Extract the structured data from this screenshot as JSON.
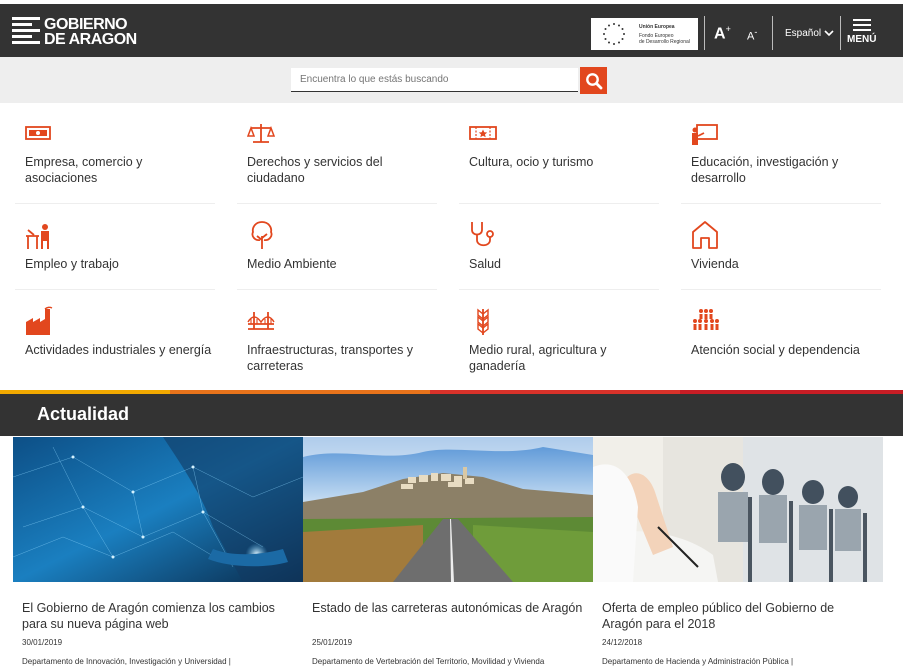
{
  "header": {
    "logo_line1": "GOBIERNO",
    "logo_line2": "DE ARAGON",
    "eu_line1": "Unión Europea",
    "eu_line2": "Fondo Europeo",
    "eu_line3": "de Desarrollo Regional",
    "font_increase": "A",
    "font_decrease": "A",
    "language": "Español",
    "menu_label": "MENÚ"
  },
  "search": {
    "placeholder": "Encuentra lo que estás buscando"
  },
  "categories": [
    {
      "label": "Empresa, comercio y asociaciones",
      "icon": "money-icon"
    },
    {
      "label": "Derechos y servicios del ciudadano",
      "icon": "scales-icon"
    },
    {
      "label": "Cultura, ocio y turismo",
      "icon": "ticket-icon"
    },
    {
      "label": "Educación, investigación y desarrollo",
      "icon": "blackboard-icon"
    },
    {
      "label": "Empleo y trabajo",
      "icon": "worker-desk-icon"
    },
    {
      "label": "Medio Ambiente",
      "icon": "tree-icon"
    },
    {
      "label": "Salud",
      "icon": "stethoscope-icon"
    },
    {
      "label": "Vivienda",
      "icon": "house-icon"
    },
    {
      "label": "Actividades industriales y energía",
      "icon": "factory-icon"
    },
    {
      "label": "Infraestructuras, transportes y carreteras",
      "icon": "bridge-icon"
    },
    {
      "label": "Medio rural, agricultura y ganadería",
      "icon": "wheat-icon"
    },
    {
      "label": "Atención social y dependencia",
      "icon": "people-group-icon"
    }
  ],
  "colors": {
    "accent": "#e2471e",
    "dark": "#333333",
    "bar": [
      "#f2a900",
      "#e8731b",
      "#d9322a",
      "#c81d25"
    ]
  },
  "news_section": {
    "title": "Actualidad",
    "items": [
      {
        "title": "El Gobierno de Aragón comienza los cambios para su nueva página web",
        "date": "30/01/2019",
        "department": "Departamento de Innovación, Investigación y Universidad   |"
      },
      {
        "title": "Estado de las carreteras autonómicas de Aragón",
        "date": "25/01/2019",
        "department": "Departamento de Vertebración del Territorio, Movilidad y Vivienda"
      },
      {
        "title": "Oferta de empleo público del Gobierno de Aragón para el 2018",
        "date": "24/12/2018",
        "department": "Departamento de Hacienda y Administración Pública   |"
      }
    ]
  }
}
